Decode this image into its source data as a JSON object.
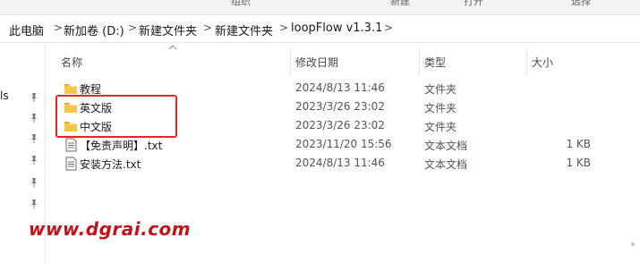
{
  "ribbon": {
    "labels": [
      "组织",
      "新建",
      "打开",
      "选择"
    ]
  },
  "breadcrumb": {
    "items": [
      "此电脑",
      "新加卷 (D:)",
      "新建文件夹",
      "新建文件夹",
      "loopFlow v1.3.1"
    ],
    "separator": ">"
  },
  "nav": {
    "fragment": "ls"
  },
  "columns": {
    "name": "名称",
    "date": "修改日期",
    "type": "类型",
    "size": "大小"
  },
  "files": [
    {
      "name": "教程",
      "date": "2024/8/13 11:46",
      "type": "文件夹",
      "size": "",
      "kind": "folder"
    },
    {
      "name": "英文版",
      "date": "2023/3/26 23:02",
      "type": "文件夹",
      "size": "",
      "kind": "folder"
    },
    {
      "name": "中文版",
      "date": "2023/3/26 23:02",
      "type": "文件夹",
      "size": "",
      "kind": "folder"
    },
    {
      "name": "【免责声明】.txt",
      "date": "2023/11/20 15:56",
      "type": "文本文档",
      "size": "1 KB",
      "kind": "text"
    },
    {
      "name": "安装方法.txt",
      "date": "2024/8/13 11:46",
      "type": "文本文档",
      "size": "1 KB",
      "kind": "text"
    }
  ],
  "watermark": "www.dgrai.com",
  "colors": {
    "highlight": "#e0282e",
    "watermark": "#c0131a",
    "folder": "#f5c84c",
    "pin": "#7a7a7a"
  },
  "icons": {
    "folder": "folder-icon",
    "text": "text-file-icon",
    "pin": "pin-icon"
  }
}
